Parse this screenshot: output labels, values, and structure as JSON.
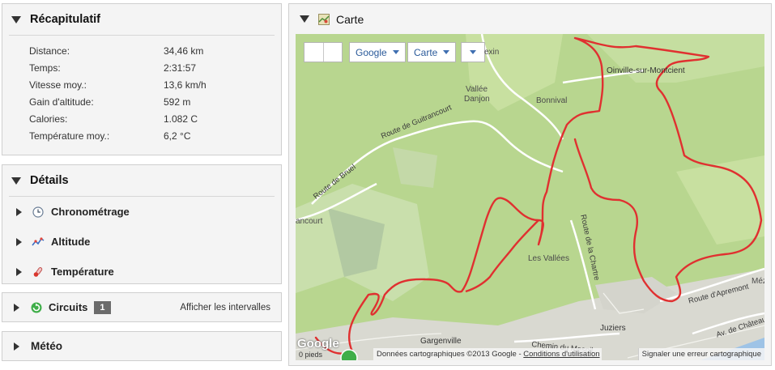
{
  "summary": {
    "title": "Récapitulatif",
    "rows": [
      {
        "label": "Distance:",
        "value": "34,46 km"
      },
      {
        "label": "Temps:",
        "value": "2:31:57"
      },
      {
        "label": "Vitesse moy.:",
        "value": "13,6 km/h"
      },
      {
        "label": "Gain d'altitude:",
        "value": "592 m"
      },
      {
        "label": "Calories:",
        "value": "1.082 C"
      },
      {
        "label": "Température moy.:",
        "value": "6,2 °C"
      }
    ]
  },
  "details": {
    "title": "Détails",
    "items": [
      {
        "label": "Chronométrage",
        "icon": "clock-icon"
      },
      {
        "label": "Altitude",
        "icon": "altitude-icon"
      },
      {
        "label": "Température",
        "icon": "thermometer-icon"
      }
    ]
  },
  "circuits": {
    "title": "Circuits",
    "count": "1",
    "link": "Afficher les intervalles"
  },
  "meteo": {
    "title": "Météo"
  },
  "map": {
    "title": "Carte",
    "controls": {
      "provider": "Google",
      "type": "Carte"
    },
    "places": {
      "oinville": "Oinville-sur-Montcient",
      "vallee": "Vallée",
      "danjon": "Danjon",
      "bonnival": "Bonnival",
      "lesvallees": "Les Vallées",
      "gargenville": "Gargenville",
      "juziers": "Juziers",
      "mez": "Méz",
      "ancourt": "ancourt",
      "exin": "exin"
    },
    "roads": {
      "guitrancourt": "Route de Guitrancourt",
      "bruel": "Route de Bruel",
      "chartre": "Route de la Chartre",
      "aprement": "Route d'Apremont",
      "chateau": "Av. de Château",
      "mesnil": "Chemin du Mesnil"
    },
    "scale": "0 pieds",
    "logo": "Google",
    "attribution": "Données cartographiques ©2013 Google",
    "terms": "Conditions d'utilisation",
    "report": "Signaler une erreur cartographique",
    "colors": {
      "track": "#e03030",
      "land": "#b8d68f",
      "road": "#ffffff",
      "urban": "#d9d9d1",
      "water": "#9ec3e6"
    }
  }
}
